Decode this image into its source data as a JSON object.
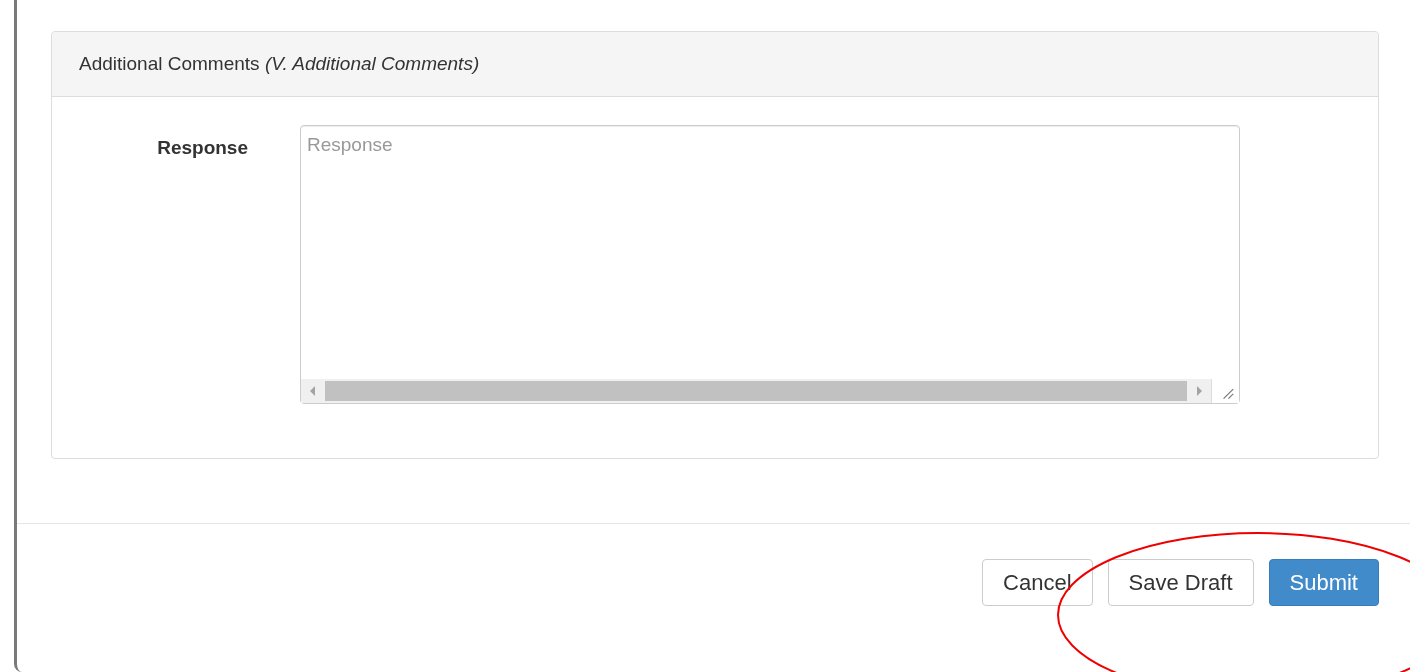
{
  "panel": {
    "title": "Additional Comments",
    "subtitle": "(V. Additional Comments)",
    "fields": [
      {
        "label": "Response",
        "placeholder": "Response"
      }
    ]
  },
  "buttons": [
    {
      "label": "Cancel",
      "kind": "default"
    },
    {
      "label": "Save Draft",
      "kind": "default"
    },
    {
      "label": "Submit",
      "kind": "primary"
    }
  ]
}
